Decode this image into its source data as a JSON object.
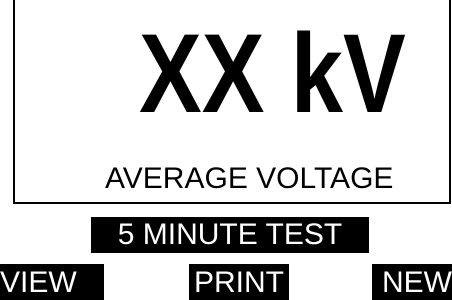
{
  "display": {
    "main_value": "XX kV",
    "main_label": "AVERAGE VOLTAGE",
    "test_mode": "5 MINUTE TEST"
  },
  "softkeys": {
    "view": "VIEW",
    "print": "PRINT",
    "new": "NEW"
  },
  "colors": {
    "background": "#ffffff",
    "foreground": "#000000",
    "inverse_text": "#ffffff"
  }
}
